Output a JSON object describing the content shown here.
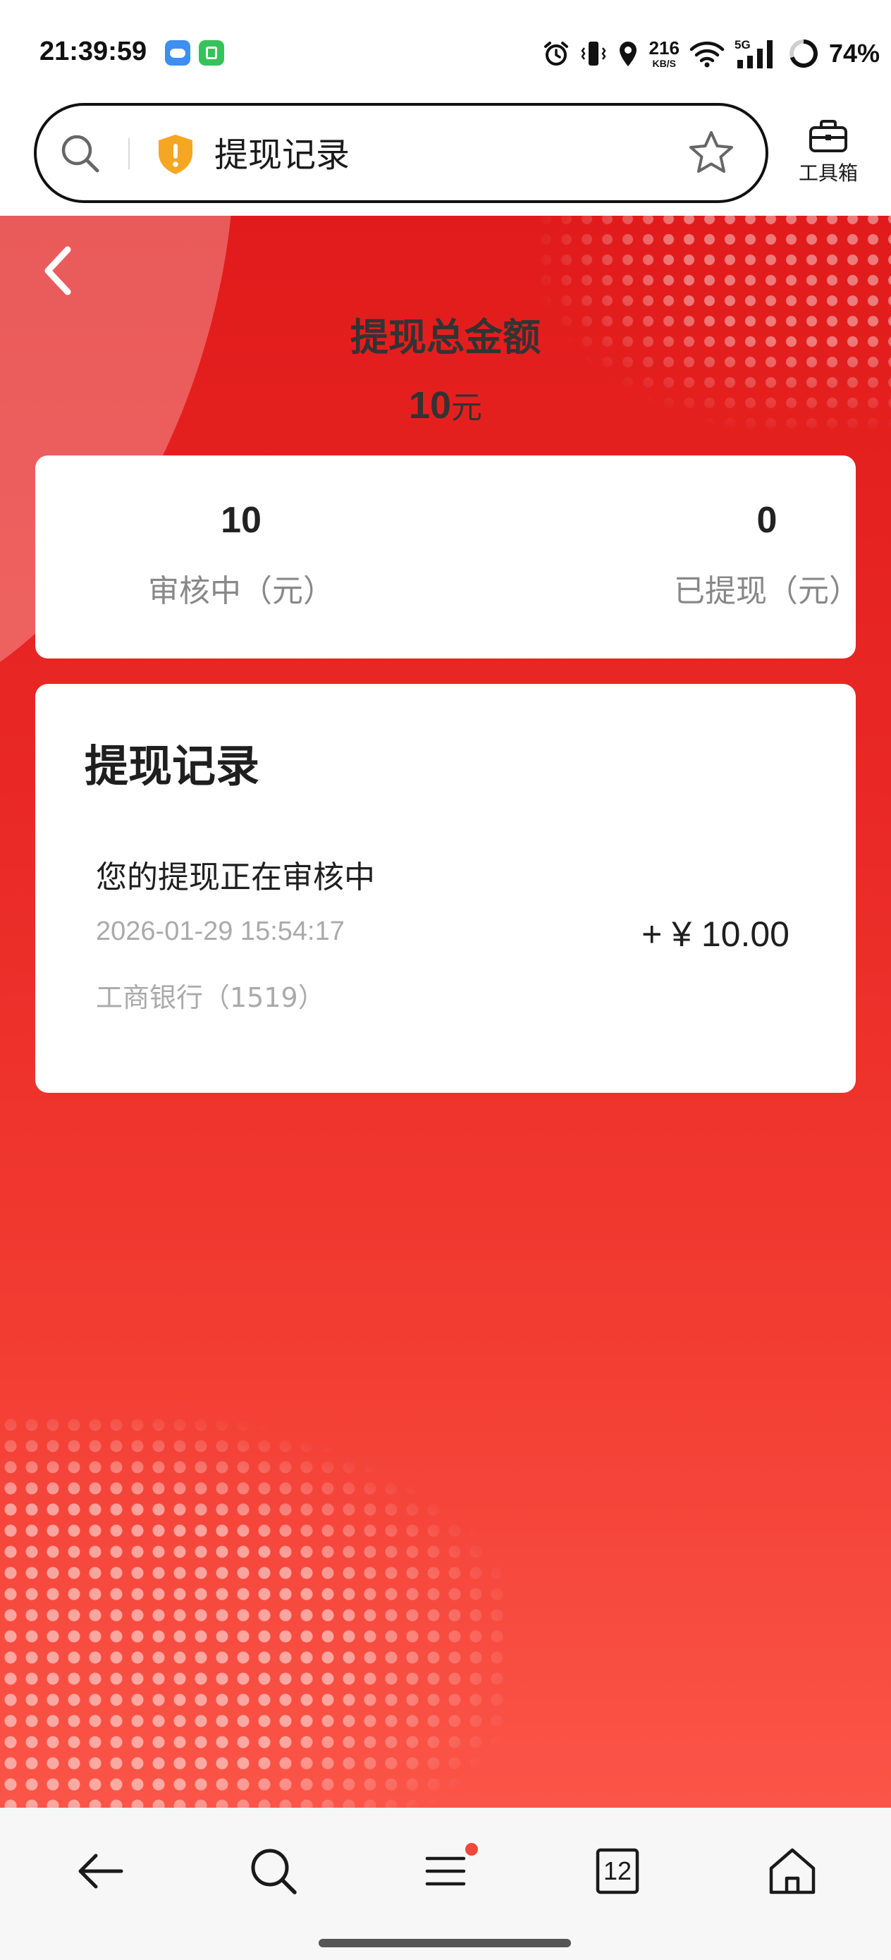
{
  "status_bar": {
    "time": "21:39:59",
    "net_speed_value": "216",
    "net_speed_unit": "KB/S",
    "network": "5G",
    "battery": "74%",
    "icons": [
      "weather-app-icon",
      "green-app-icon",
      "alarm-icon",
      "vibrate-icon",
      "location-icon",
      "wifi-icon",
      "cellular-signal-icon",
      "battery-icon"
    ]
  },
  "browser": {
    "address_title": "提现记录",
    "toolbox_label": "工具箱"
  },
  "header": {
    "total_label": "提现总金额",
    "total_amount": "10",
    "total_unit": "元"
  },
  "summary": {
    "pending_value": "10",
    "pending_label": "审核中（元）",
    "withdrawn_value": "0",
    "withdrawn_label": "已提现（元）"
  },
  "records": {
    "title": "提现记录",
    "items": [
      {
        "status": "您的提现正在审核中",
        "time": "2026-01-29 15:54:17",
        "bank": "工商银行（1519）",
        "amount": "+ ¥ 10.00"
      }
    ]
  },
  "bottom_nav": {
    "tab_count": "12"
  },
  "colors": {
    "background_red": "#e11b1b",
    "badge_dot": "#f0483a",
    "shield": "#f5a623"
  }
}
